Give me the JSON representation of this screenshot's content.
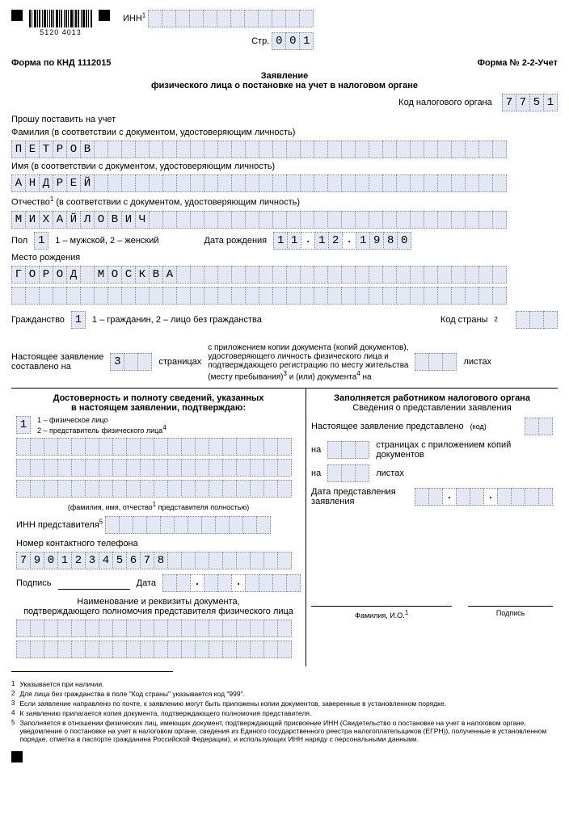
{
  "header": {
    "inn_label": "ИНН",
    "inn_sup": "1",
    "inn_value": "",
    "page_label": "Стр.",
    "page_value": "001",
    "barcode_num": "5120   4013",
    "form_left": "Форма по КНД 1112015",
    "form_right": "Форма № 2-2-Учет",
    "title_line1": "Заявление",
    "title_line2": "физического лица о постановке на учет в налоговом органе",
    "tax_code_label": "Код налогового органа",
    "tax_code_value": "7751"
  },
  "req": {
    "label": "Прошу поставить на учет"
  },
  "surname": {
    "label": "Фамилия (в соответствии с документом, удостоверяющим личность)",
    "value": "ПЕТРОВ"
  },
  "name": {
    "label": "Имя (в соответствии с документом, удостоверяющим личность)",
    "value": "АНДРЕЙ"
  },
  "patronymic": {
    "label_pre": "Отчество",
    "label_sup": "1",
    "label_post": " (в соответствии с документом, удостоверяющим личность)",
    "value": "МИХАЙЛОВИЧ"
  },
  "gender": {
    "label": "Пол",
    "value": "1",
    "hint": "1 – мужской, 2 – женский"
  },
  "dob": {
    "label": "Дата рождения",
    "value": "11.12.1980"
  },
  "birthplace": {
    "label": "Место рождения",
    "value": "ГОРОД МОСКВА"
  },
  "citizenship": {
    "label": "Гражданство",
    "value": "1",
    "hint": "1 – гражданин, 2 – лицо без гражданства",
    "country_label": "Код страны",
    "country_sup": "2",
    "country_value": ""
  },
  "compose": {
    "line1": "Настоящее заявление",
    "line2": "составлено на",
    "pages_value": "3",
    "pages_word": "страницах",
    "middle_text1": "с приложением копии документа (копий документов),",
    "middle_text2": "удостоверяющего личность физического лица и",
    "middle_text3": "подтверждающего регистрацию по месту жительства",
    "middle_text4_pre": "(месту пребывания)",
    "middle_sup1": "3",
    "middle_text4_mid": " и (или) документа",
    "middle_sup2": "4",
    "middle_text4_post": " на",
    "sheets_value": "",
    "sheets_word": "листах"
  },
  "left_col": {
    "title1": "Достоверность и полноту сведений, указанных",
    "title2": "в настоящем заявлении, подтверждаю:",
    "type_value": "1",
    "type_hint1": "1 – физическое лицо",
    "type_hint2_pre": "2 – представитель физического лица",
    "type_hint2_sup": "4",
    "fio_hint_pre": "(фамилия, имя, отчество",
    "fio_hint_sup": "1",
    "fio_hint_post": " представителя полностью)",
    "rep_inn_label": "ИНН представителя",
    "rep_inn_sup": "5",
    "phone_label": "Номер контактного телефона",
    "phone_value": "79012345678",
    "sign_label": "Подпись",
    "date_label": "Дата",
    "doc_line1": "Наименование и реквизиты документа,",
    "doc_line2": "подтверждающего полномочия представителя физического лица"
  },
  "right_col": {
    "title": "Заполняется работником налогового органа",
    "subtitle": "Сведения о представлении заявления",
    "l1": "Настоящее заявление представлено",
    "l1_small": "(код)",
    "l2_pre": "на",
    "l2_post": "страницах с приложением копий документов",
    "l3_pre": "на",
    "l3_post": "листах",
    "l4a": "Дата представления",
    "l4b": "заявления",
    "fio_label": "Фамилия, И.О.",
    "fio_sup": "1",
    "sign_label": "Подпись"
  },
  "footnotes": {
    "f1": "Указывается при наличии.",
    "f2": "Для лица без гражданства в поле \"Код страны\" указывается код \"999\".",
    "f3": "Если заявление направлено по почте, к заявлению могут быть приложены копии документов, заверенные в установленном порядке.",
    "f4": "К заявлению прилагается копия документа, подтверждающего полномочия представителя.",
    "f5": "Заполняется в отношении физических лиц, имеющих документ, подтверждающий присвоение ИНН (Свидетельство о постановке на учет в налоговом органе, уведомление о постановке на учет в налоговом органе, сведения из Единого государственного реестра налогоплательщиков (ЕГРН)), полученные в установленном порядке, отметка в паспорте гражданина Российской Федерации), и использующих ИНН наряду с персональными данными."
  }
}
